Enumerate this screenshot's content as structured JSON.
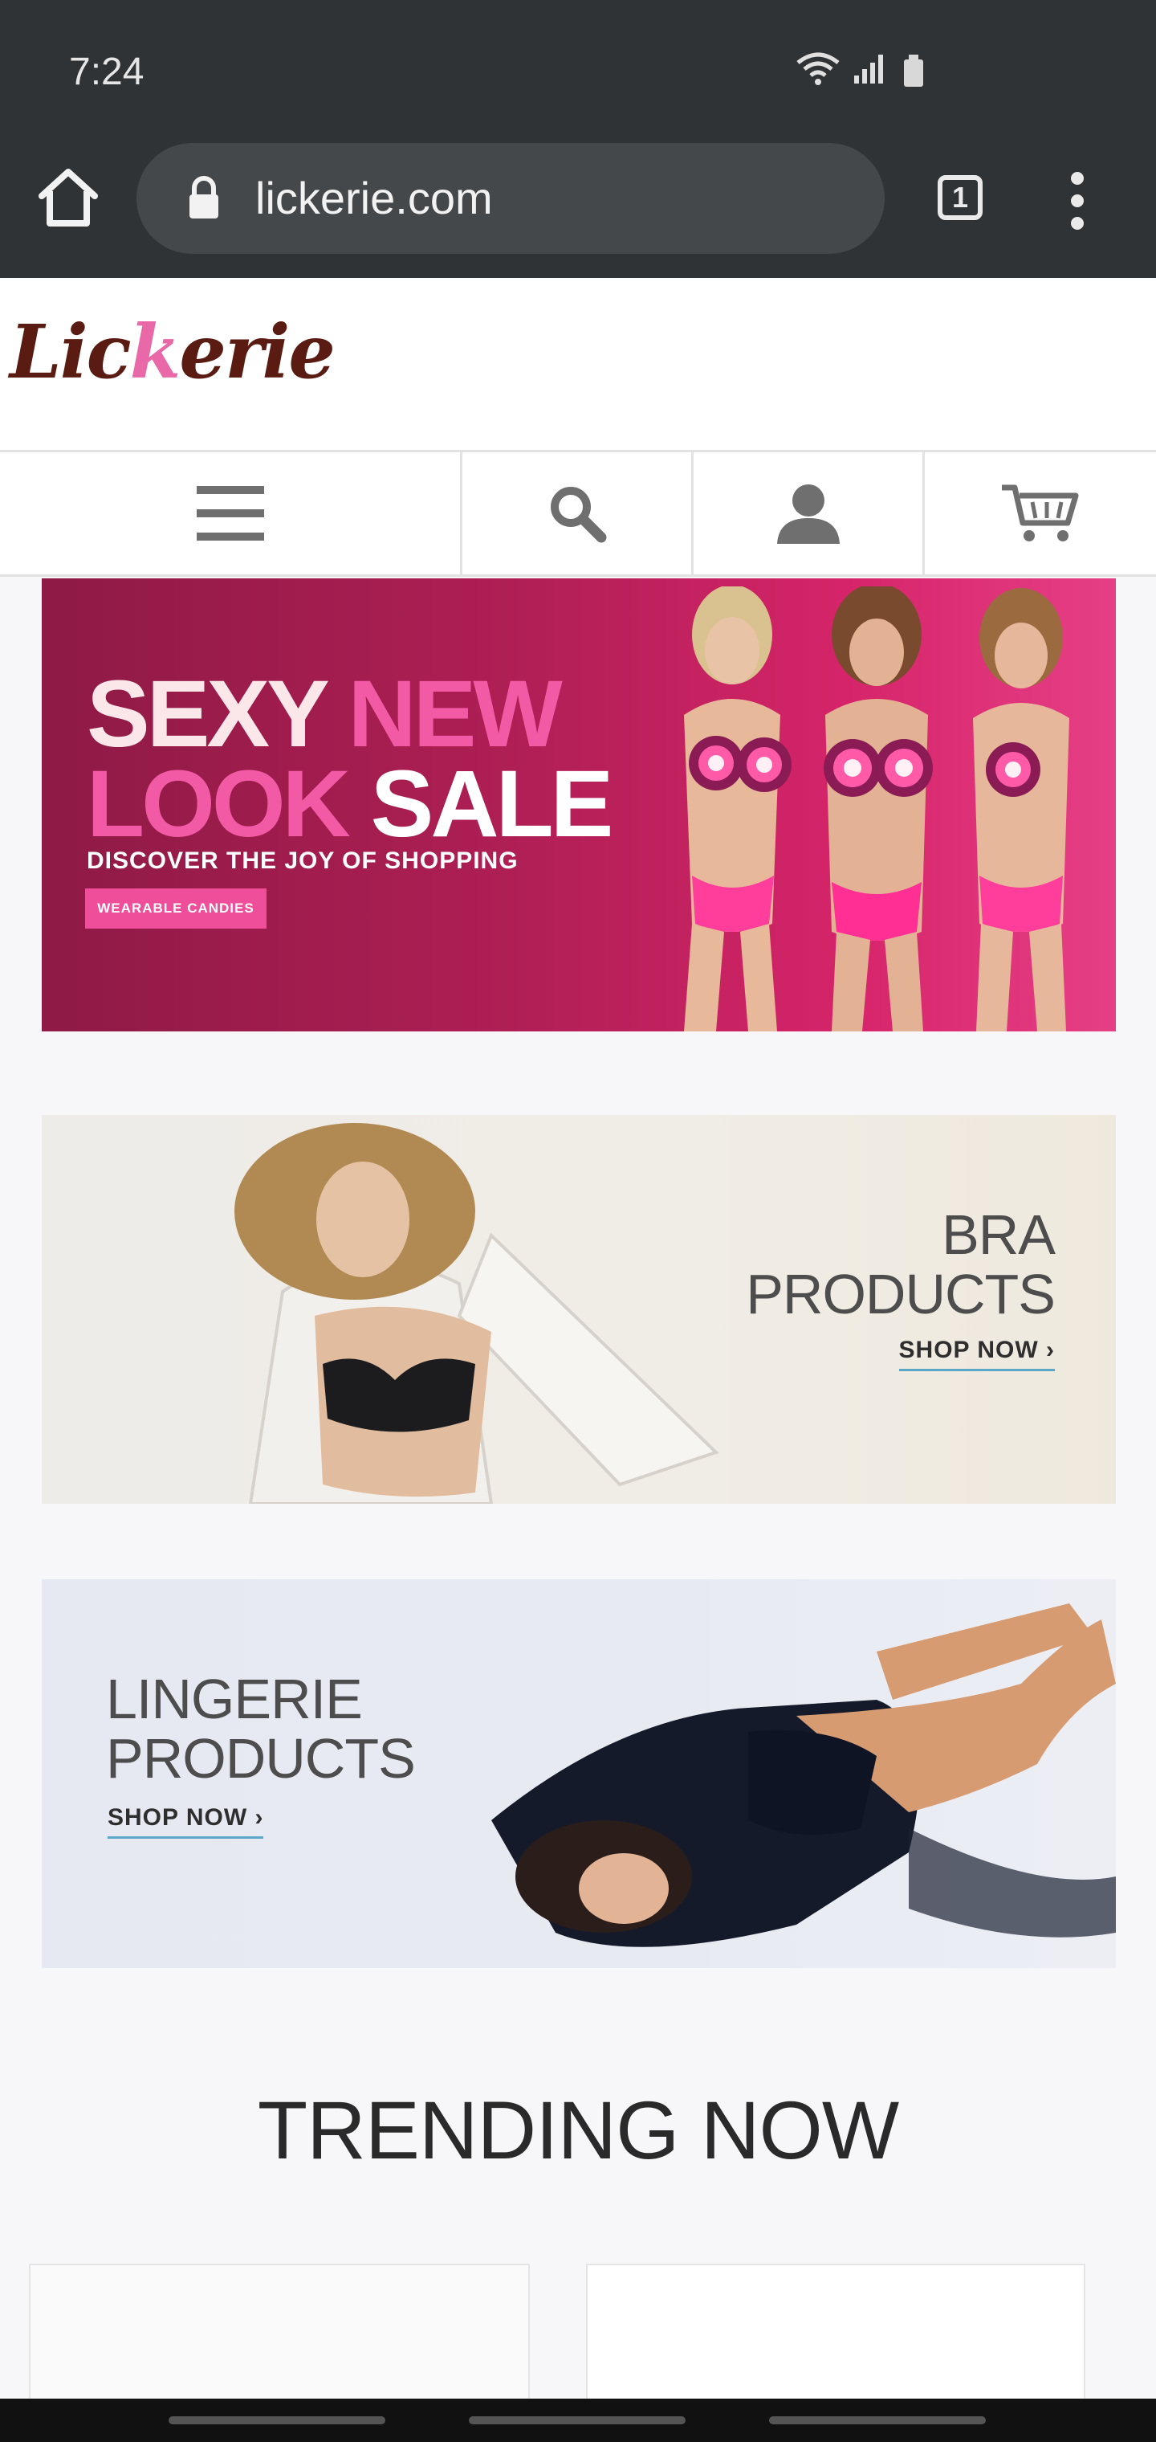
{
  "status_bar": {
    "time": "7:24"
  },
  "browser": {
    "url": "lickerie.com",
    "tab_count": "1"
  },
  "site": {
    "logo_text_a": "Lic",
    "logo_text_b": "k",
    "logo_text_c": "erie"
  },
  "banners": {
    "sale": {
      "word_sexy": "SEXY",
      "word_new": "NEW",
      "word_look": "LOOK",
      "word_sale": "SALE",
      "tagline": "DISCOVER THE JOY OF SHOPPING",
      "button_label": "WEARABLE CANDIES"
    },
    "bra": {
      "title_line1": "BRA",
      "title_line2": "PRODUCTS",
      "shop_label": "SHOP NOW ›"
    },
    "lingerie": {
      "title_line1": "LINGERIE",
      "title_line2": "PRODUCTS",
      "shop_label": "SHOP NOW ›"
    }
  },
  "sections": {
    "trending_title": "TRENDING NOW"
  },
  "colors": {
    "accent_pink": "#ef4f9a",
    "logo_brown": "#5a1c12",
    "chrome": "#303336"
  }
}
